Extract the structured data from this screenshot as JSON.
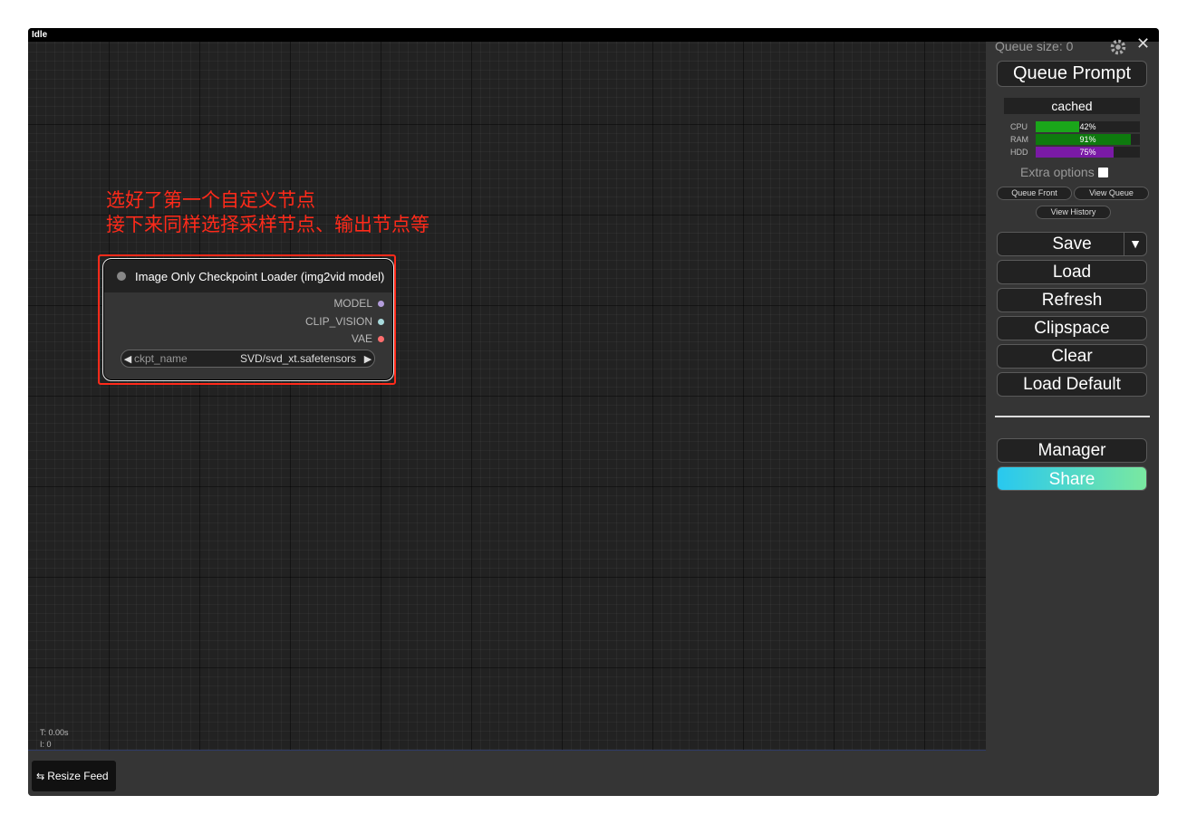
{
  "window": {
    "status": "Idle"
  },
  "annotation": {
    "line1": "选好了第一个自定义节点",
    "line2": "接下来同样选择采样节点、输出节点等",
    "color": "#ff2a1a"
  },
  "node": {
    "title": "Image Only Checkpoint Loader (img2vid model)",
    "outputs": [
      {
        "label": "MODEL",
        "color": "#b39ddb"
      },
      {
        "label": "CLIP_VISION",
        "color": "#a8dadc"
      },
      {
        "label": "VAE",
        "color": "#ff6e6e"
      }
    ],
    "widget": {
      "name": "ckpt_name",
      "value": "SVD/svd_xt.safetensors",
      "left_arrow": "◀",
      "right_arrow": "▶"
    }
  },
  "stats": {
    "time": "T: 0.00s",
    "iter": "I: 0"
  },
  "feed": {
    "resize_label": "Resize Feed",
    "icon": "resize-arrows-icon"
  },
  "menu": {
    "queue_size": "Queue size: 0",
    "queue_prompt": "Queue Prompt",
    "cached": "cached",
    "monitors": [
      {
        "label": "CPU",
        "value": 42,
        "text": "42%",
        "color": "#1aa61a"
      },
      {
        "label": "RAM",
        "value": 91,
        "text": "91%",
        "color": "#0e7a0e"
      },
      {
        "label": "HDD",
        "value": 75,
        "text": "75%",
        "color": "#7a1aa6"
      }
    ],
    "extra_options": "Extra options",
    "queue_front": "Queue Front",
    "view_queue": "View Queue",
    "view_history": "View History",
    "save": "Save",
    "save_dropdown": "▼",
    "load": "Load",
    "refresh": "Refresh",
    "clipspace": "Clipspace",
    "clear": "Clear",
    "load_default": "Load Default",
    "manager": "Manager",
    "share": "Share",
    "close": "✕"
  }
}
